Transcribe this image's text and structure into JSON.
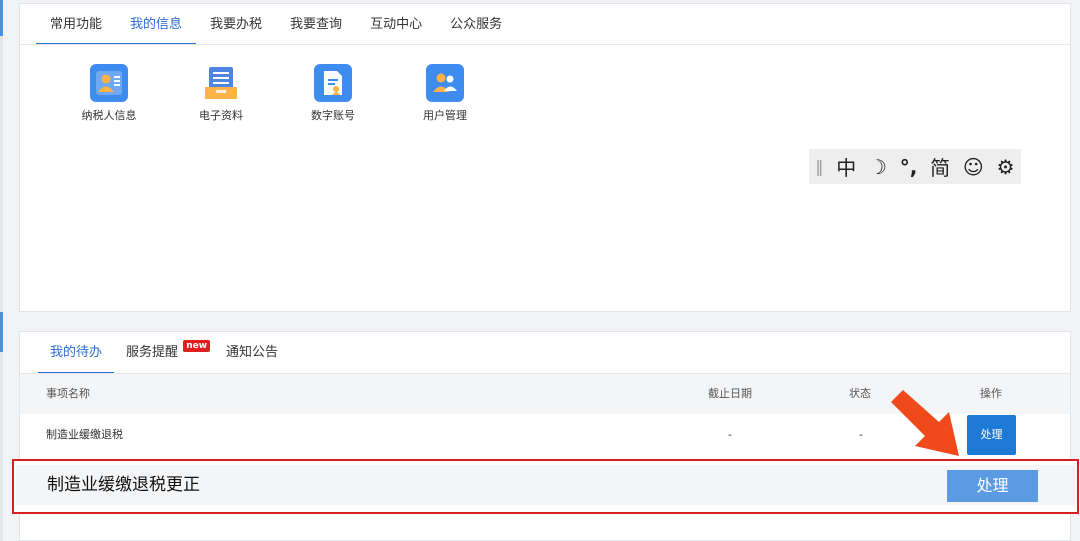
{
  "nav_tabs": [
    "常用功能",
    "我的信息",
    "我要办税",
    "我要查询",
    "互动中心",
    "公众服务"
  ],
  "active_nav_tab": "我的信息",
  "info_items": [
    {
      "label": "纳税人信息",
      "icon": "taxpayer-id-card-icon",
      "color": "#3f8cf0"
    },
    {
      "label": "电子资料",
      "icon": "electronic-docs-icon",
      "color": "#4f86e6"
    },
    {
      "label": "数字账号",
      "icon": "digital-account-icon",
      "color": "#3f8cf0"
    },
    {
      "label": "用户管理",
      "icon": "user-management-icon",
      "color": "#3f8cf0"
    }
  ],
  "ime_toolbar": {
    "chinese": "中",
    "moon": "☽",
    "punct": "°,",
    "simplified": "简",
    "emoji": "☺",
    "settings": "⚙"
  },
  "bottom_tabs": {
    "todo": "我的待办",
    "reminder": "服务提醒",
    "new_badge": "new",
    "notice": "通知公告"
  },
  "table": {
    "headers": {
      "name": "事项名称",
      "deadline": "截止日期",
      "status": "状态",
      "action": "操作"
    },
    "rows": [
      {
        "name": "制造业缓缴退税",
        "deadline": "-",
        "status": "-",
        "action": "处理"
      }
    ]
  },
  "highlight_row": {
    "name": "制造业缓缴退税更正",
    "action": "处理"
  },
  "colors": {
    "accent": "#2b6fd6",
    "button": "#1f7ad6",
    "highlight_border": "#d81e1e",
    "arrow": "#f04a1c"
  }
}
